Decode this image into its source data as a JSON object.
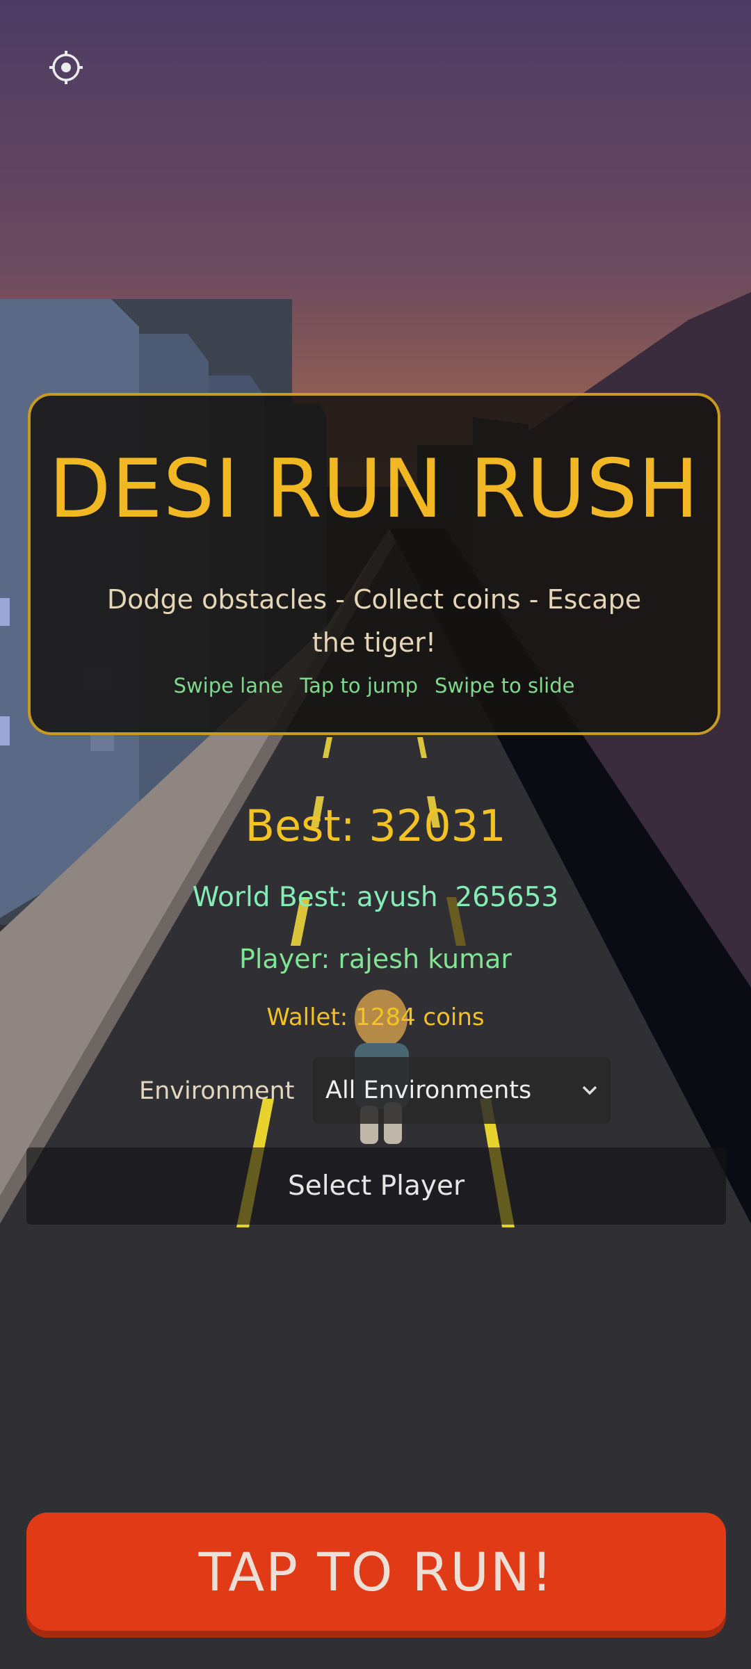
{
  "colors": {
    "accent_gold": "#f2b824",
    "hint_green": "#7fd88c",
    "world_best_mint": "#86ecb6",
    "player_green": "#7fe493",
    "run_button": "#e13a16",
    "panel_border": "#c79a22"
  },
  "settings": {
    "icon": "settings-gear-icon"
  },
  "title_panel": {
    "title": "DESI RUN RUSH",
    "tagline": "Dodge obstacles - Collect coins - Escape the tiger!",
    "hints": [
      "Swipe lane",
      "Tap to jump",
      "Swipe to slide"
    ]
  },
  "stats": {
    "best": "Best: 32031",
    "world_best": "World Best: ayush  265653",
    "player": "Player: rajesh kumar",
    "wallet": "Wallet: 1284 coins"
  },
  "environment": {
    "label": "Environment",
    "selected": "All Environments",
    "icon": "chevron-down-icon"
  },
  "buttons": {
    "select_player": "Select Player",
    "tap_to_run": "TAP TO RUN!"
  }
}
